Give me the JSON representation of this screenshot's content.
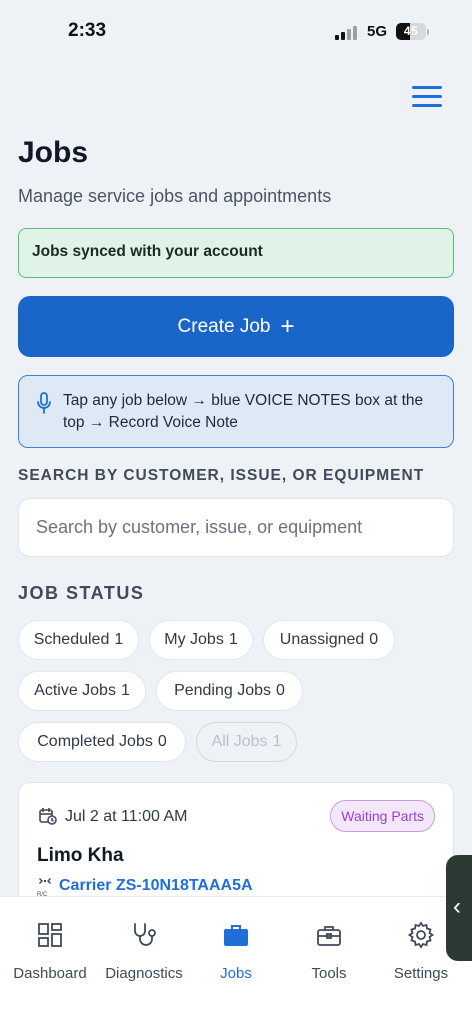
{
  "status_bar": {
    "time": "2:33",
    "network": "5G",
    "battery": "45",
    "battery_level": 0.45
  },
  "header": {
    "menu_icon": "hamburger-menu-icon",
    "title": "Jobs",
    "subtitle": "Manage service jobs and appointments"
  },
  "sync_notice": "Jobs synced with your account",
  "create_job": {
    "label": "Create Job",
    "icon": "+"
  },
  "voice_tip": {
    "icon": "microphone-icon",
    "text": "Tap any job below → blue VOICE NOTES box at the top → Record Voice Note"
  },
  "search": {
    "label": "SEARCH BY CUSTOMER, ISSUE, OR EQUIPMENT",
    "placeholder": "Search by customer, issue, or equipment",
    "value": ""
  },
  "job_status": {
    "label": "JOB STATUS",
    "filters": [
      {
        "label": "Scheduled",
        "count": "1"
      },
      {
        "label": "My Jobs",
        "count": "1"
      },
      {
        "label": "Unassigned",
        "count": "0"
      },
      {
        "label": "Active Jobs",
        "count": "1"
      },
      {
        "label": "Pending Jobs",
        "count": "0"
      },
      {
        "label": "Completed Jobs",
        "count": "0"
      },
      {
        "label": "All Jobs",
        "count": "1"
      }
    ]
  },
  "job": {
    "date": "Jul 2 at 11:00 AM",
    "status": "Waiting Parts",
    "customer": "Limo Kha",
    "equipment": "Carrier ZS-10N18TAAA5A",
    "colors": {
      "badge_text": "#9a3fcf",
      "badge_bg": "#f3e8fb"
    }
  },
  "side_handle": "‹",
  "tabs": [
    {
      "label": "Dashboard",
      "icon": "dashboard-grid-icon"
    },
    {
      "label": "Diagnostics",
      "icon": "stethoscope-icon"
    },
    {
      "label": "Jobs",
      "icon": "briefcase-icon",
      "active": true
    },
    {
      "label": "Tools",
      "icon": "toolbox-icon"
    },
    {
      "label": "Settings",
      "icon": "gear-icon"
    }
  ],
  "colors": {
    "primary": "#1966c8",
    "success_border": "#5dbb7a",
    "success_bg": "#dff3e6",
    "info_bg": "#dfe9f6"
  }
}
